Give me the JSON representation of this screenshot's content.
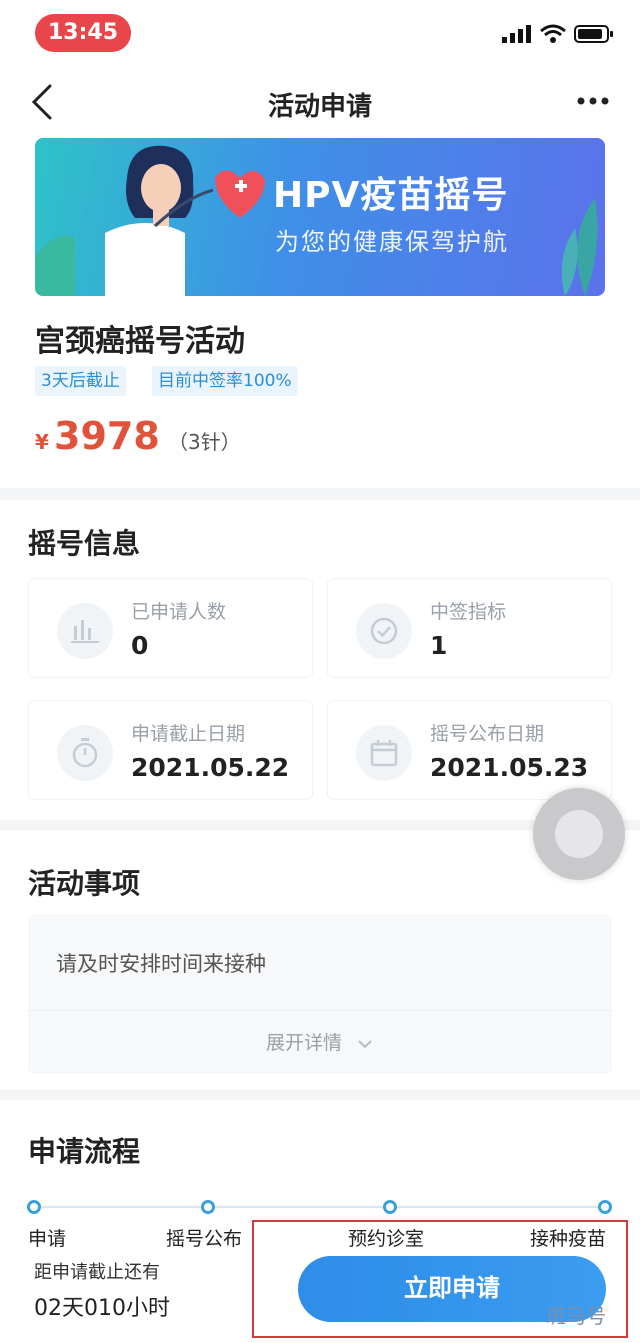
{
  "status_bar": {
    "time": "13:45"
  },
  "nav": {
    "title": "活动申请"
  },
  "banner": {
    "title": "HPV疫苗摇号",
    "subtitle": "为您的健康保驾护航"
  },
  "activity": {
    "title": "宫颈癌摇号活动",
    "tags": [
      "3天后截止",
      "目前中签率100%"
    ],
    "price_symbol": "¥",
    "price": "3978",
    "price_note": "（3针）"
  },
  "info": {
    "title": "摇号信息",
    "cells": [
      {
        "label": "已申请人数",
        "value": "0",
        "icon": "bar-chart-icon"
      },
      {
        "label": "中签指标",
        "value": "1",
        "icon": "check-circle-icon"
      },
      {
        "label": "申请截止日期",
        "value": "2021.05.22",
        "icon": "stopwatch-icon"
      },
      {
        "label": "摇号公布日期",
        "value": "2021.05.23",
        "icon": "calendar-icon"
      }
    ]
  },
  "matters": {
    "title": "活动事项",
    "text": "请及时安排时间来接种",
    "expand_label": "展开详情"
  },
  "process": {
    "title": "申请流程",
    "steps": [
      "申请",
      "摇号公布",
      "预约诊室",
      "接种疫苗"
    ]
  },
  "bottom": {
    "countdown_label": "距申请截止还有",
    "countdown_value": "02天010小时",
    "apply_label": "立即申请"
  },
  "watermark": "斑马号",
  "colors": {
    "accent": "#3aa0dc",
    "price": "#e0533a",
    "button": "#2d8de8",
    "highlight": "#d93a3a"
  }
}
